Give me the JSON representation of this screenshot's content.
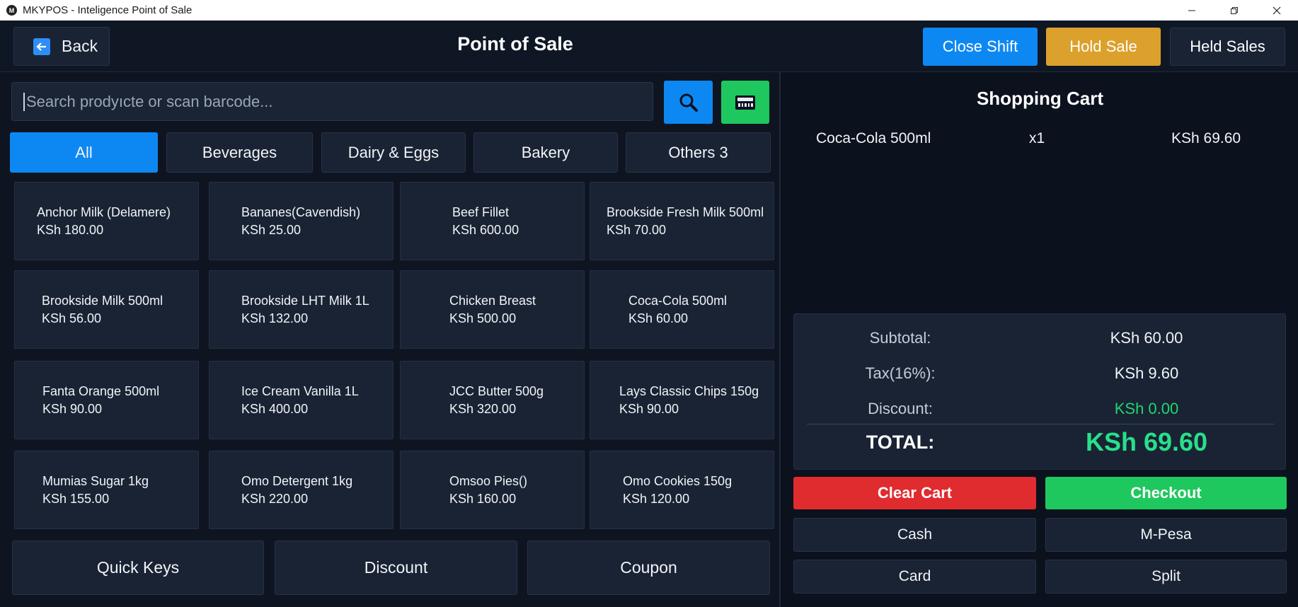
{
  "window": {
    "title": "MKYPOS - Inteligence Point of Sale",
    "controls": [
      "minimize",
      "maximize",
      "close"
    ]
  },
  "header": {
    "back_label": "Back",
    "title": "Point of Sale",
    "close_shift_label": "Close Shift",
    "hold_sale_label": "Hold Sale",
    "held_sales_label": "Held Sales"
  },
  "search": {
    "placeholder": "Search prodyıcte or scan barcode..."
  },
  "categories": [
    {
      "label": "All",
      "active": true
    },
    {
      "label": "Beverages",
      "active": false
    },
    {
      "label": "Dairy & Eggs",
      "active": false
    },
    {
      "label": "Bakery",
      "active": false
    },
    {
      "label": "Others 3",
      "active": false
    }
  ],
  "products": [
    {
      "name": "Anchor Milk (Delamere)",
      "price": "KSh 180.00"
    },
    {
      "name": "Bananes(Cavendish)",
      "price": "KSh 25.00"
    },
    {
      "name": "Beef Fillet",
      "price": "KSh 600.00"
    },
    {
      "name": "Brookside Fresh Milk 500ml",
      "price": "KSh 70.00"
    },
    {
      "name": "Brookside Milk 500ml",
      "price": "KSh 56.00"
    },
    {
      "name": "Brookside LHT Milk 1L",
      "price": "KSh 132.00"
    },
    {
      "name": "Chicken Breast",
      "price": "KSh 500.00"
    },
    {
      "name": "Coca-Cola 500ml",
      "price": "KSh 60.00"
    },
    {
      "name": "Fanta Orange 500ml",
      "price": "KSh 90.00"
    },
    {
      "name": "Ice Cream Vanilla 1L",
      "price": "KSh 400.00"
    },
    {
      "name": "JCC Butter 500g",
      "price": "KSh 320.00"
    },
    {
      "name": "Lays Classic Chips 150g",
      "price": "KSh 90.00"
    },
    {
      "name": "Mumias Sugar 1kg",
      "price": "KSh 155.00"
    },
    {
      "name": "Omo Detergent 1kg",
      "price": "KSh 220.00"
    },
    {
      "name": "Omsoo Pies()",
      "price": "KSh 160.00"
    },
    {
      "name": "Omo Cookies 150g",
      "price": "KSh 120.00"
    }
  ],
  "bottom_actions": {
    "quick_keys": "Quick Keys",
    "discount": "Discount",
    "coupon": "Coupon"
  },
  "cart": {
    "title": "Shopping Cart",
    "items": [
      {
        "name": "Coca-Cola 500ml",
        "qty": "x1",
        "total": "KSh 69.60"
      }
    ],
    "subtotal_label": "Subtotal:",
    "subtotal": "KSh 60.00",
    "tax_label": "Tax(16%):",
    "tax": "KSh 9.60",
    "discount_label": "Discount:",
    "discount": "KSh 0.00",
    "total_label": "TOTAL:",
    "total": "KSh 69.60"
  },
  "payment": {
    "clear_cart": "Clear Cart",
    "checkout": "Checkout",
    "cash": "Cash",
    "mpesa": "M-Pesa",
    "card": "Card",
    "split": "Split"
  },
  "colors": {
    "background": "#0e1521",
    "panel": "#1a2334",
    "primary_blue": "#0d88f2",
    "hold_amber": "#dca12c",
    "success_green": "#1ec85e",
    "danger_red": "#e02b2f",
    "total_green": "#28e08a"
  }
}
